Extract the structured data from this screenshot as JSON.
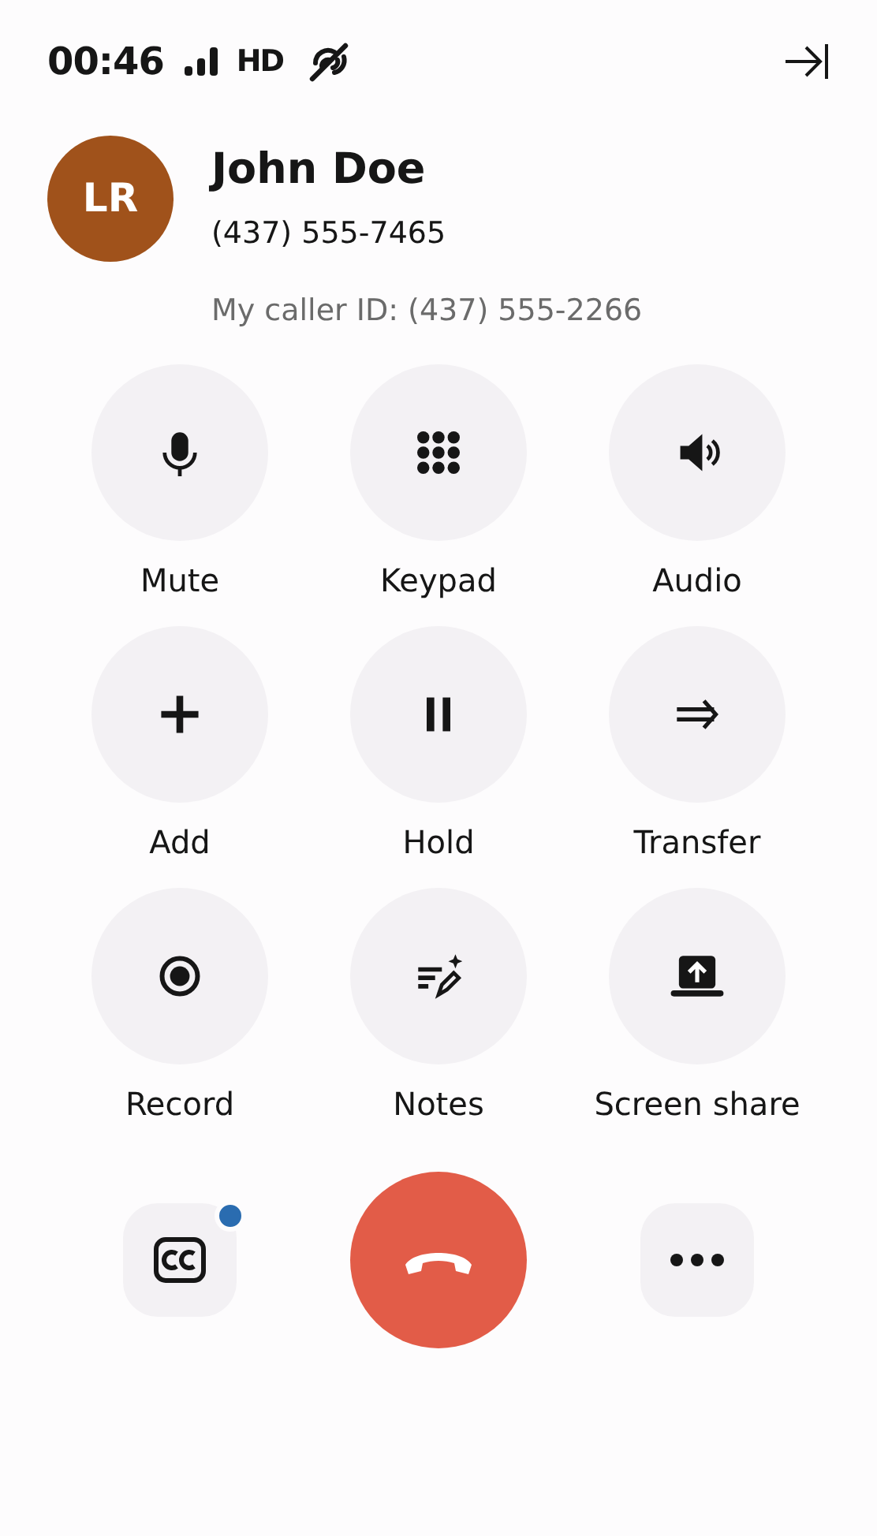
{
  "status_bar": {
    "time": "00:46",
    "quality": "HD"
  },
  "contact": {
    "initials": "LR",
    "name": "John Doe",
    "number": "(437) 555-7465",
    "caller_id": "My caller ID: (437) 555-2266"
  },
  "actions": [
    {
      "label": "Mute"
    },
    {
      "label": "Keypad"
    },
    {
      "label": "Audio"
    },
    {
      "label": "Add"
    },
    {
      "label": "Hold"
    },
    {
      "label": "Transfer"
    },
    {
      "label": "Record"
    },
    {
      "label": "Notes"
    },
    {
      "label": "Screen share"
    }
  ],
  "bottom_bar": {
    "captions": {
      "notification": true
    }
  }
}
